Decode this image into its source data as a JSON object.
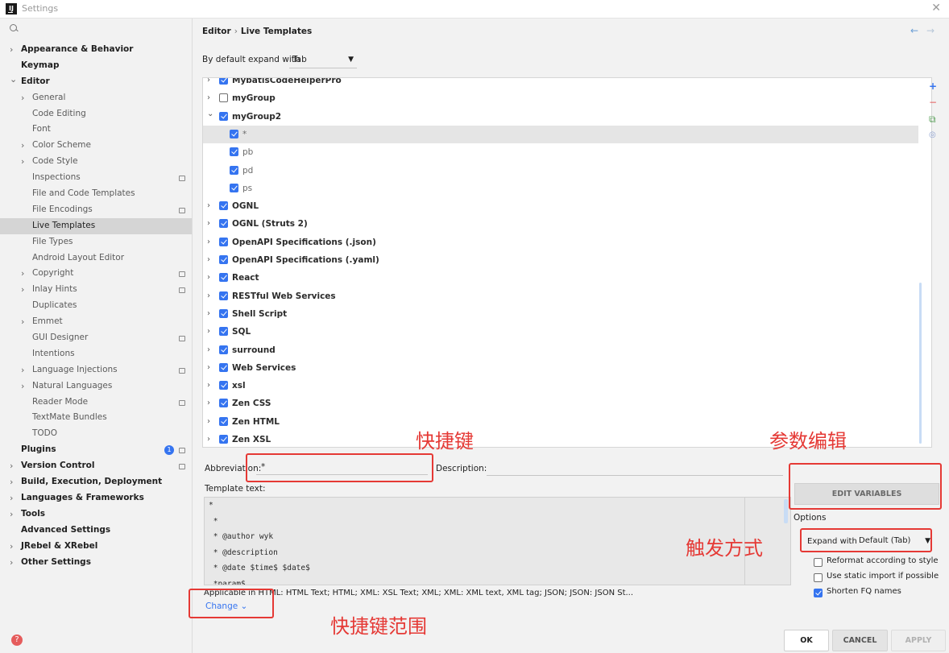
{
  "window": {
    "title": "Settings",
    "app_icon": "IJ"
  },
  "search": {
    "placeholder": ""
  },
  "sidebar": {
    "items": [
      {
        "label": "Appearance & Behavior",
        "level": 0,
        "arrow": ">",
        "bold": true
      },
      {
        "label": "Keymap",
        "level": 0,
        "arrow": "",
        "bold": true
      },
      {
        "label": "Editor",
        "level": 0,
        "arrow": "v",
        "bold": true
      },
      {
        "label": "General",
        "level": 1,
        "arrow": ">"
      },
      {
        "label": "Code Editing",
        "level": 1,
        "arrow": ""
      },
      {
        "label": "Font",
        "level": 1,
        "arrow": ""
      },
      {
        "label": "Color Scheme",
        "level": 1,
        "arrow": ">"
      },
      {
        "label": "Code Style",
        "level": 1,
        "arrow": ">"
      },
      {
        "label": "Inspections",
        "level": 1,
        "arrow": "",
        "badge": true
      },
      {
        "label": "File and Code Templates",
        "level": 1,
        "arrow": ""
      },
      {
        "label": "File Encodings",
        "level": 1,
        "arrow": "",
        "badge": true
      },
      {
        "label": "Live Templates",
        "level": 1,
        "arrow": "",
        "selected": true
      },
      {
        "label": "File Types",
        "level": 1,
        "arrow": ""
      },
      {
        "label": "Android Layout Editor",
        "level": 1,
        "arrow": ""
      },
      {
        "label": "Copyright",
        "level": 1,
        "arrow": ">",
        "badge": true
      },
      {
        "label": "Inlay Hints",
        "level": 1,
        "arrow": ">",
        "badge": true
      },
      {
        "label": "Duplicates",
        "level": 1,
        "arrow": ""
      },
      {
        "label": "Emmet",
        "level": 1,
        "arrow": ">"
      },
      {
        "label": "GUI Designer",
        "level": 1,
        "arrow": "",
        "badge": true
      },
      {
        "label": "Intentions",
        "level": 1,
        "arrow": ""
      },
      {
        "label": "Language Injections",
        "level": 1,
        "arrow": ">",
        "badge": true
      },
      {
        "label": "Natural Languages",
        "level": 1,
        "arrow": ">"
      },
      {
        "label": "Reader Mode",
        "level": 1,
        "arrow": "",
        "badge": true
      },
      {
        "label": "TextMate Bundles",
        "level": 1,
        "arrow": ""
      },
      {
        "label": "TODO",
        "level": 1,
        "arrow": ""
      },
      {
        "label": "Plugins",
        "level": 0,
        "arrow": "",
        "bold": true,
        "badge": true,
        "count": "1"
      },
      {
        "label": "Version Control",
        "level": 0,
        "arrow": ">",
        "bold": true,
        "badge": true
      },
      {
        "label": "Build, Execution, Deployment",
        "level": 0,
        "arrow": ">",
        "bold": true
      },
      {
        "label": "Languages & Frameworks",
        "level": 0,
        "arrow": ">",
        "bold": true
      },
      {
        "label": "Tools",
        "level": 0,
        "arrow": ">",
        "bold": true
      },
      {
        "label": "Advanced Settings",
        "level": 0,
        "arrow": "",
        "bold": true
      },
      {
        "label": "JRebel & XRebel",
        "level": 0,
        "arrow": ">",
        "bold": true
      },
      {
        "label": "Other Settings",
        "level": 0,
        "arrow": ">",
        "bold": true
      }
    ]
  },
  "breadcrumb": {
    "part1": "Editor",
    "sep": "›",
    "part2": "Live Templates"
  },
  "expand_default": {
    "label": "By default expand with",
    "value": "Tab"
  },
  "templates": [
    {
      "name": "MybatisCodeHelperPro",
      "type": "group",
      "arrow": ">",
      "checked": true,
      "partial": true
    },
    {
      "name": "myGroup",
      "type": "group",
      "arrow": ">",
      "checked": false
    },
    {
      "name": "myGroup2",
      "type": "group",
      "arrow": "v",
      "checked": true
    },
    {
      "name": "*",
      "type": "item",
      "checked": true,
      "selected": true
    },
    {
      "name": "pb",
      "type": "item",
      "checked": true
    },
    {
      "name": "pd",
      "type": "item",
      "checked": true
    },
    {
      "name": "ps",
      "type": "item",
      "checked": true
    },
    {
      "name": "OGNL",
      "type": "group",
      "arrow": ">",
      "checked": true
    },
    {
      "name": "OGNL (Struts 2)",
      "type": "group",
      "arrow": ">",
      "checked": true
    },
    {
      "name": "OpenAPI Specifications (.json)",
      "type": "group",
      "arrow": ">",
      "checked": true
    },
    {
      "name": "OpenAPI Specifications (.yaml)",
      "type": "group",
      "arrow": ">",
      "checked": true
    },
    {
      "name": "React",
      "type": "group",
      "arrow": ">",
      "checked": true
    },
    {
      "name": "RESTful Web Services",
      "type": "group",
      "arrow": ">",
      "checked": true
    },
    {
      "name": "Shell Script",
      "type": "group",
      "arrow": ">",
      "checked": true
    },
    {
      "name": "SQL",
      "type": "group",
      "arrow": ">",
      "checked": true
    },
    {
      "name": "surround",
      "type": "group",
      "arrow": ">",
      "checked": true
    },
    {
      "name": "Web Services",
      "type": "group",
      "arrow": ">",
      "checked": true
    },
    {
      "name": "xsl",
      "type": "group",
      "arrow": ">",
      "checked": true
    },
    {
      "name": "Zen CSS",
      "type": "group",
      "arrow": ">",
      "checked": true
    },
    {
      "name": "Zen HTML",
      "type": "group",
      "arrow": ">",
      "checked": true
    },
    {
      "name": "Zen XSL",
      "type": "group",
      "arrow": ">",
      "checked": true
    }
  ],
  "tools": {
    "add": "+",
    "remove": "−",
    "copy": "⧉",
    "restore": "◎"
  },
  "abbreviation": {
    "label": "Abbreviation:",
    "value": "*"
  },
  "description": {
    "label": "Description:",
    "value": ""
  },
  "template_text": {
    "label": "Template text:",
    "lines": [
      "*",
      " *",
      " * @author wyk",
      " * @description",
      " * @date $time$ $date$",
      " *param$"
    ]
  },
  "applicable": {
    "text": "Applicable in HTML: HTML Text; HTML; XML: XSL Text; XML; XML: XML text, XML tag; JSON; JSON: JSON St...",
    "change": "Change ⌄"
  },
  "edit_variables": "EDIT VARIABLES",
  "options": {
    "label": "Options",
    "expand_with_label": "Expand with",
    "expand_with_value": "Default (Tab)",
    "checkboxes": [
      {
        "label": "Reformat according to style",
        "checked": false
      },
      {
        "label": "Use static import if possible",
        "checked": false
      },
      {
        "label": "Shorten FQ names",
        "checked": true
      }
    ]
  },
  "buttons": {
    "ok": "OK",
    "cancel": "CANCEL",
    "apply": "APPLY"
  },
  "annotations": {
    "shortcut": "快捷键",
    "param_edit": "参数编辑",
    "trigger": "触发方式",
    "scope": "快捷键范围"
  },
  "colors": {
    "accent": "#3574f0",
    "annotation": "#e53935"
  }
}
